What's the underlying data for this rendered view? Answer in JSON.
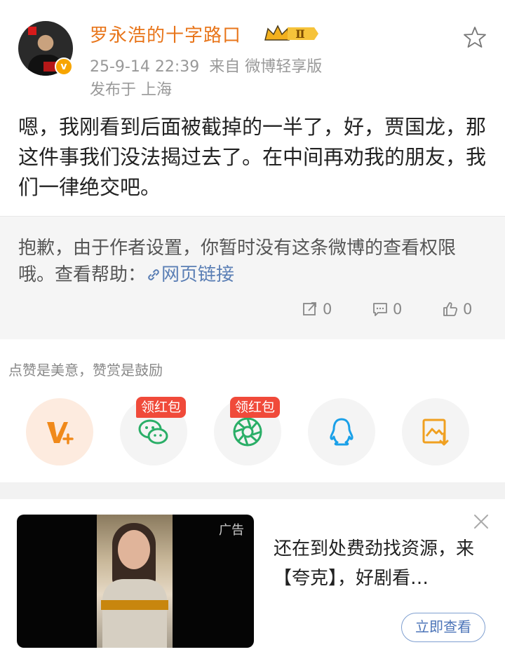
{
  "post": {
    "username": "罗永浩的十字路口",
    "time": "25-9-14 22:39",
    "source": "来自 微博轻享版",
    "location": "发布于 上海",
    "badge_level": "Ⅱ",
    "verified_mark": "v",
    "text": "嗯，我刚看到后面被截掉的一半了，好，贾国龙，那这件事我们没法揭过去了。在中间再劝我的朋友，我们一律绝交吧。"
  },
  "retweet": {
    "notice": "抱歉，由于作者设置，你暂时没有这条微博的查看权限哦。查看帮助：",
    "link_label": "网页链接",
    "repost_count": "0",
    "comment_count": "0",
    "like_count": "0"
  },
  "reward": {
    "note": "点赞是美意，赞赏是鼓励",
    "redpacket_label": "领红包",
    "buttons": [
      {
        "icon": "reward-v-plus-icon",
        "color": "#f0891a"
      },
      {
        "icon": "wechat-icon",
        "color": "#2aae67"
      },
      {
        "icon": "moments-icon",
        "color": "#2aae67"
      },
      {
        "icon": "qq-icon",
        "color": "#1aa0e8"
      },
      {
        "icon": "save-image-icon",
        "color": "#f0a020"
      }
    ]
  },
  "ad": {
    "tag": "广告",
    "title": "还在到处费劲找资源，来【夸克】，好剧看…",
    "button_label": "立即查看"
  },
  "colors": {
    "username": "#e8751a",
    "link": "#5b7fb5",
    "redpacket": "#f04a3a",
    "retweet_bg": "#f5f5f5"
  }
}
